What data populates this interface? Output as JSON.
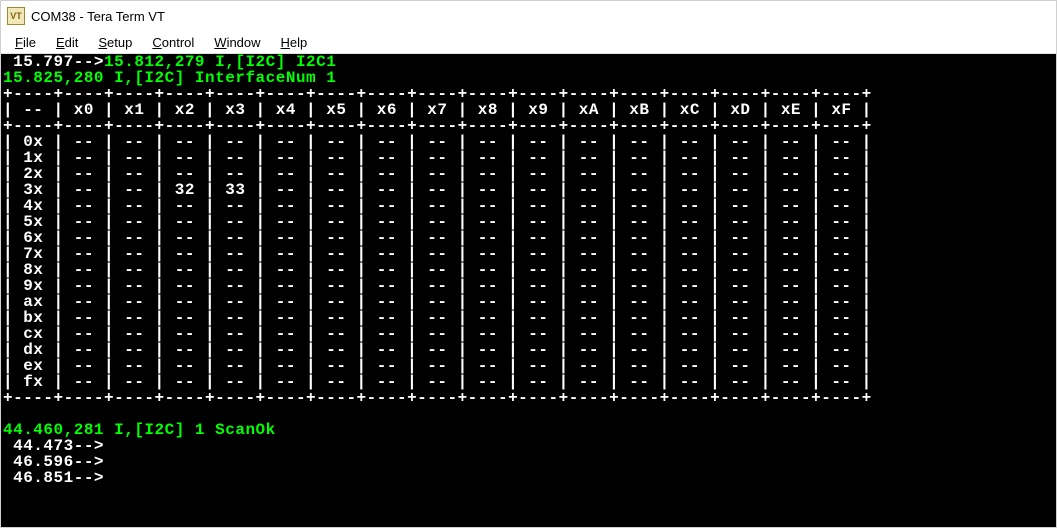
{
  "titlebar": {
    "icon_label": "VT",
    "title": "COM38 - Tera Term VT"
  },
  "menubar": {
    "items": [
      {
        "accel": "F",
        "rest": "ile"
      },
      {
        "accel": "E",
        "rest": "dit"
      },
      {
        "accel": "S",
        "rest": "etup"
      },
      {
        "accel": "C",
        "rest": "ontrol"
      },
      {
        "accel": "W",
        "rest": "indow"
      },
      {
        "accel": "H",
        "rest": "elp"
      }
    ]
  },
  "log": {
    "l1a": " 15.797-->",
    "l1b": "15.812,279 I,[I2C] I2C1",
    "l2": "15.825,280 I,[I2C] InterfaceNum 1",
    "scanok": "44.460,281 I,[I2C] 1 ScanOk",
    "t1": " 44.473-->",
    "t2": " 46.596-->",
    "t3": " 46.851-->"
  },
  "table": {
    "col_headers": [
      "--",
      "x0",
      "x1",
      "x2",
      "x3",
      "x4",
      "x5",
      "x6",
      "x7",
      "x8",
      "x9",
      "xA",
      "xB",
      "xC",
      "xD",
      "xE",
      "xF"
    ],
    "row_headers": [
      "0x",
      "1x",
      "2x",
      "3x",
      "4x",
      "5x",
      "6x",
      "7x",
      "8x",
      "9x",
      "ax",
      "bx",
      "cx",
      "dx",
      "ex",
      "fx"
    ],
    "cells": {
      "3x": {
        "x2": "32",
        "x3": "33"
      }
    },
    "empty": "--"
  }
}
